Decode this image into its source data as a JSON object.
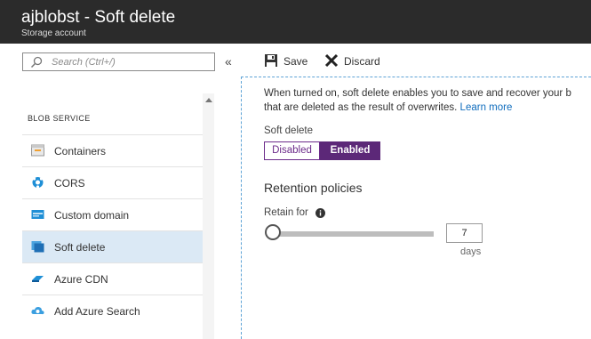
{
  "header": {
    "title": "ajblobst - Soft delete",
    "subtitle": "Storage account"
  },
  "search": {
    "placeholder": "Search (Ctrl+/)",
    "icon": "search-icon"
  },
  "collapse_label": "«",
  "menu": {
    "section_label": "BLOB SERVICE",
    "items": [
      {
        "label": "Containers",
        "icon": "containers-icon",
        "selected": false
      },
      {
        "label": "CORS",
        "icon": "cors-icon",
        "selected": false
      },
      {
        "label": "Custom domain",
        "icon": "custom-domain-icon",
        "selected": false
      },
      {
        "label": "Soft delete",
        "icon": "soft-delete-icon",
        "selected": true
      },
      {
        "label": "Azure CDN",
        "icon": "azure-cdn-icon",
        "selected": false
      },
      {
        "label": "Add Azure Search",
        "icon": "azure-search-icon",
        "selected": false
      }
    ]
  },
  "toolbar": {
    "save_label": "Save",
    "discard_label": "Discard"
  },
  "content": {
    "description_line1": "When turned on, soft delete enables you to save and recover your b",
    "description_line2": "that are deleted as the result of overwrites.",
    "learn_more": "Learn more",
    "soft_delete_label": "Soft delete",
    "toggle": {
      "off_label": "Disabled",
      "on_label": "Enabled",
      "selected": "Enabled"
    },
    "retention_title": "Retention policies",
    "retain_label": "Retain for",
    "retain_value": "7",
    "retain_unit": "days",
    "slider_fraction": 0.0
  },
  "colors": {
    "header_bg": "#2b2b2b",
    "accent_purple": "#5c2878",
    "selected_item_bg": "#dbe9f5",
    "link": "#0f6cbd"
  }
}
